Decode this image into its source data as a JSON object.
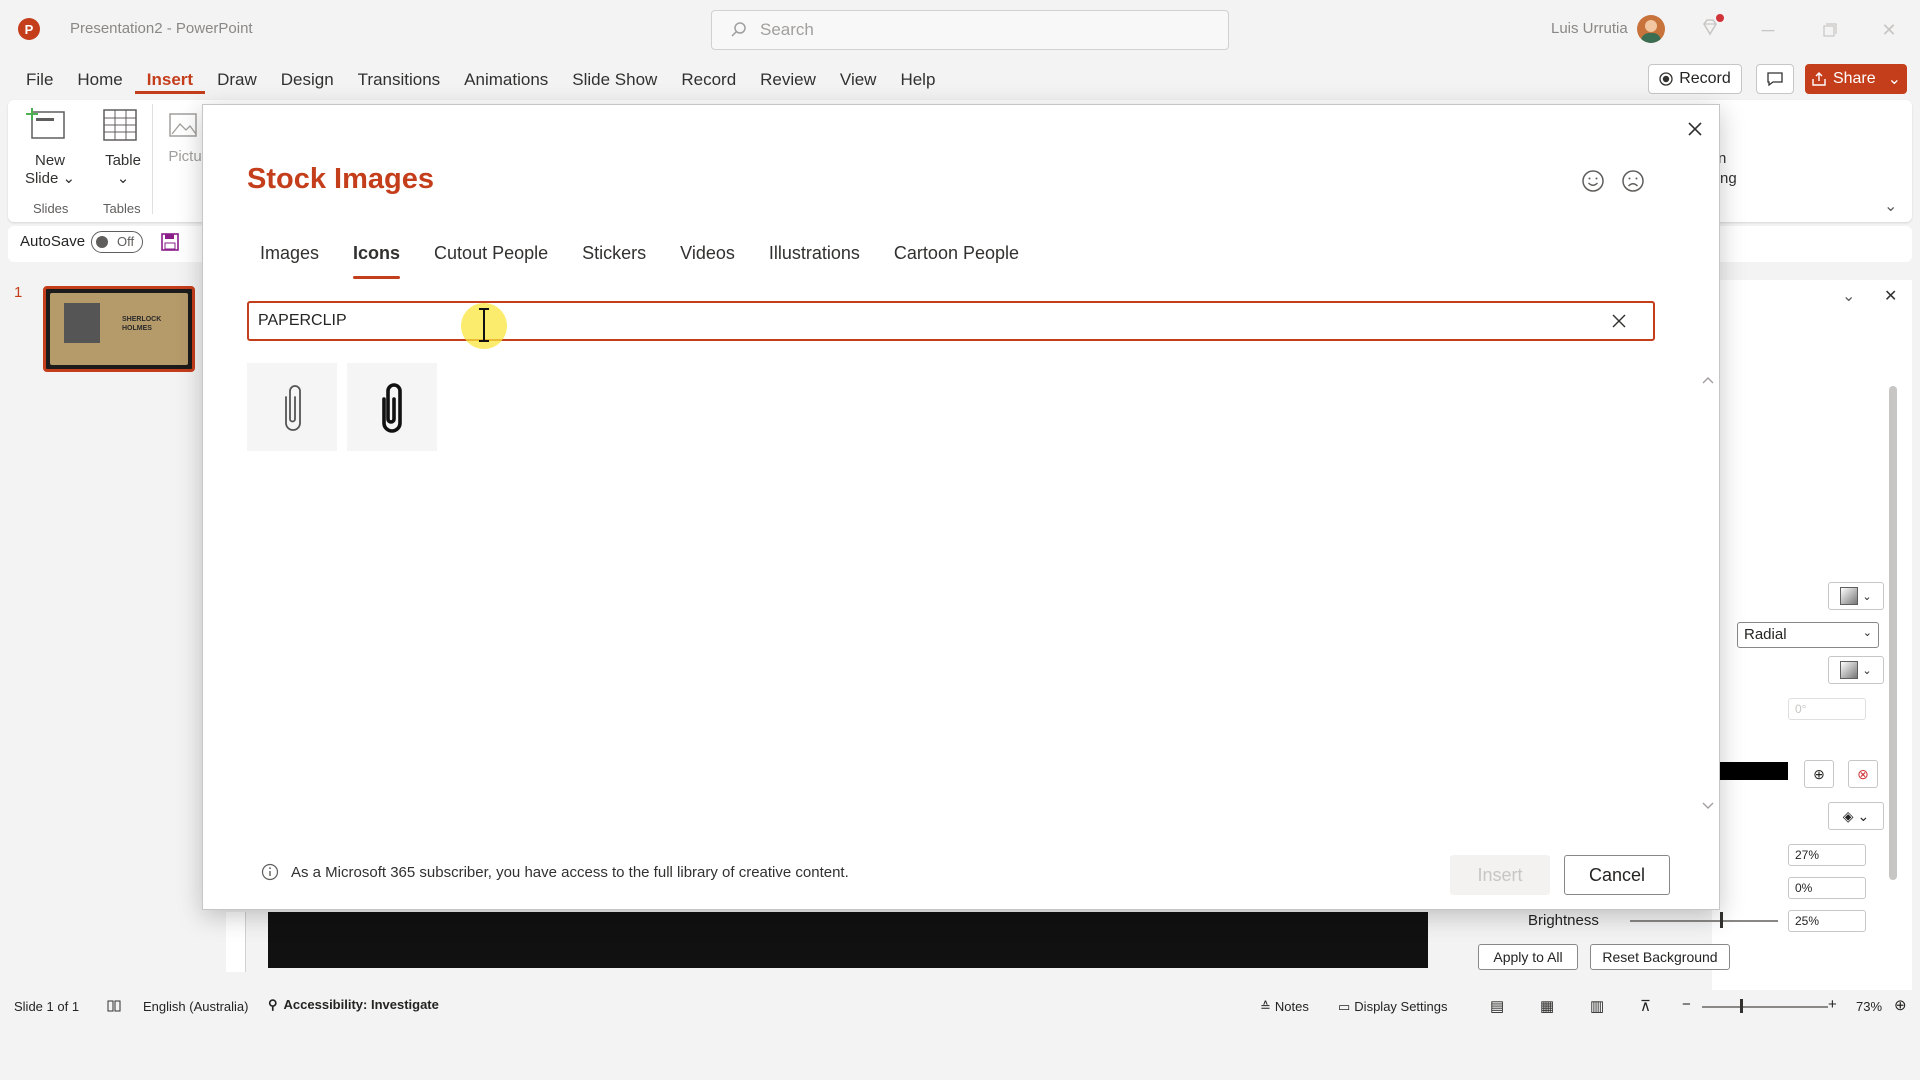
{
  "app": {
    "window_title": "Presentation2  -  PowerPoint",
    "logo_letter": "P",
    "search_placeholder": "Search",
    "user_name": "Luis Urrutia"
  },
  "menu": {
    "items": [
      "File",
      "Home",
      "Insert",
      "Draw",
      "Design",
      "Transitions",
      "Animations",
      "Slide Show",
      "Record",
      "Review",
      "View",
      "Help"
    ],
    "active": "Insert",
    "record_label": "Record",
    "share_label": "Share"
  },
  "ribbon": {
    "new_slide_line1": "New",
    "new_slide_line2": "Slide",
    "table_label": "Table",
    "pictures_label": "Pictu",
    "group_slides": "Slides",
    "group_tables": "Tables",
    "right_partial_1": "n",
    "right_partial_2": "ng"
  },
  "autosave": {
    "label": "AutoSave",
    "state": "Off"
  },
  "slides_panel": {
    "slide_number": "1",
    "thumb_title_line1": "SHERLOCK",
    "thumb_title_line2": "HOLMES"
  },
  "format_pane": {
    "gradient_type": "Radial",
    "angle_value": "0°",
    "transparency_value": "27%",
    "brightness_pos": "0%",
    "brightness_label": "Brightness",
    "brightness_value": "25%",
    "apply_all": "Apply to All",
    "reset_bg": "Reset Background"
  },
  "dialog": {
    "title": "Stock Images",
    "tabs": [
      "Images",
      "Icons",
      "Cutout People",
      "Stickers",
      "Videos",
      "Illustrations",
      "Cartoon People"
    ],
    "active_tab": "Icons",
    "search_value": "PAPERCLIP",
    "results": [
      "paperclip-thin-icon",
      "paperclip-bold-icon"
    ],
    "info_text": "As a Microsoft 365 subscriber, you have access to the full library of creative content.",
    "insert_label": "Insert",
    "cancel_label": "Cancel"
  },
  "statusbar": {
    "slide_info": "Slide 1 of 1",
    "language": "English (Australia)",
    "accessibility": "Accessibility: Investigate",
    "notes": "Notes",
    "display_settings": "Display Settings",
    "zoom": "73%"
  },
  "colors": {
    "accent": "#c43e1c"
  }
}
